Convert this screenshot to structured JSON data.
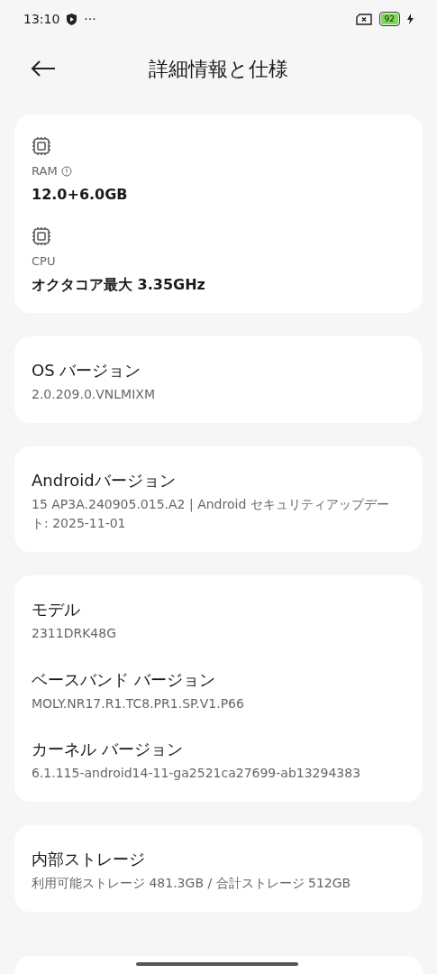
{
  "status_bar": {
    "time": "13:10",
    "more": "···",
    "battery": "92"
  },
  "header": {
    "title": "詳細情報と仕様"
  },
  "cards": [
    {
      "items": [
        {
          "kind": "spec",
          "label": "RAM",
          "info": true,
          "value": "12.0+6.0GB"
        },
        {
          "kind": "spec",
          "label": "CPU",
          "info": false,
          "value": "オクタコア最大 3.35GHz"
        }
      ]
    },
    {
      "items": [
        {
          "kind": "entry",
          "title": "OS バージョン",
          "value": "2.0.209.0.VNLMIXM"
        }
      ]
    },
    {
      "items": [
        {
          "kind": "entry",
          "title": "Androidバージョン",
          "value": "15 AP3A.240905.015.A2 | Android セキュリティアップデート: 2025-11-01"
        }
      ]
    },
    {
      "items": [
        {
          "kind": "entry",
          "title": "モデル",
          "value": "2311DRK48G"
        },
        {
          "kind": "entry",
          "title": "ベースバンド バージョン",
          "value": "MOLY.NR17.R1.TC8.PR1.SP.V1.P66"
        },
        {
          "kind": "entry",
          "title": "カーネル バージョン",
          "value": "6.1.115-android14-11-ga2521ca27699-ab13294383"
        }
      ]
    },
    {
      "items": [
        {
          "kind": "entry",
          "title": "内部ストレージ",
          "value": "利用可能ストレージ  481.3GB / 合計ストレージ 512GB"
        }
      ]
    }
  ]
}
